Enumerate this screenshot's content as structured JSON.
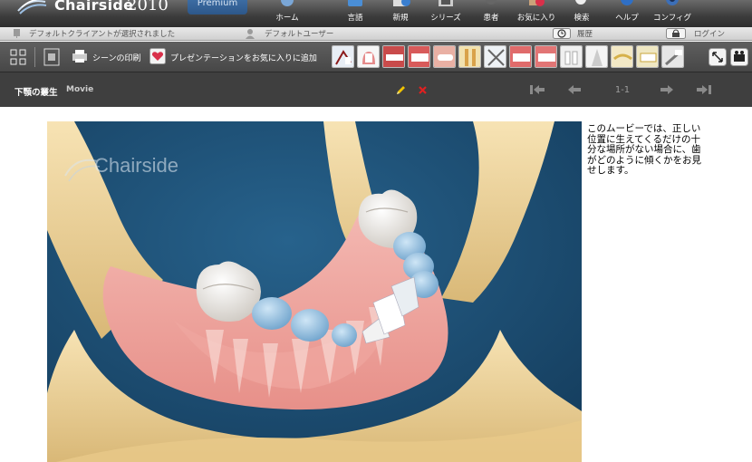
{
  "app": {
    "brand": "Chairside",
    "year": "2010",
    "edition": "Premium"
  },
  "nav": [
    {
      "label": "ホーム",
      "icon": "home-icon"
    },
    {
      "label": "言語",
      "icon": "language-icon"
    },
    {
      "label": "新規",
      "icon": "new-icon"
    },
    {
      "label": "シリーズ",
      "icon": "series-icon"
    },
    {
      "label": "患者",
      "icon": "patient-icon"
    },
    {
      "label": "お気に入り",
      "icon": "favorites-icon"
    },
    {
      "label": "検索",
      "icon": "search-icon"
    },
    {
      "label": "ヘルプ",
      "icon": "help-icon"
    },
    {
      "label": "コンフィグ",
      "icon": "config-icon"
    }
  ],
  "status": {
    "client": "デフォルトクライアントが選択されました",
    "user": "デフォルトユーザー",
    "history": "履歴",
    "login": "ログイン"
  },
  "toolbar": {
    "print_label": "シーンの印刷",
    "favorite_label": "プレゼンテーションをお気に入りに追加"
  },
  "scene": {
    "title": "下顎の叢生",
    "type": "Movie",
    "counter": "1-1",
    "watermark": "Chairside",
    "description": "このムービーでは、正しい位置に生えてくるだけの十分な場所がない場合に、歯がどのように傾くかをお見せします。"
  },
  "colors": {
    "accent_blue": "#2d578a",
    "edit_pencil": "#f2c400",
    "delete_x": "#e02020",
    "favorite_heart": "#d9304a"
  }
}
